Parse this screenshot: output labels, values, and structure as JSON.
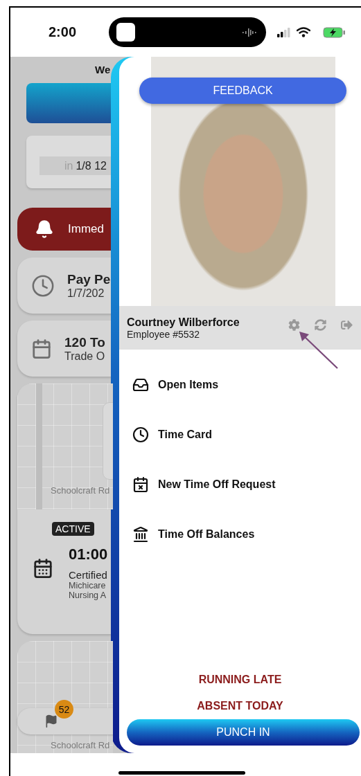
{
  "status_bar": {
    "time": "2:00"
  },
  "background_screen": {
    "heading": "We",
    "clock_prefix": "in",
    "clock_value": "1/8 12",
    "alert": "Immed",
    "cards": [
      {
        "kind": "clock",
        "title": "Pay Pe",
        "subtitle": "1/7/202"
      },
      {
        "kind": "calendar",
        "title": "120 To",
        "subtitle": "Trade O"
      }
    ],
    "shift": {
      "map_label": "Schoolcraft Rd",
      "status": "ACTIVE",
      "time": "01:00",
      "title": "Certified",
      "lines": [
        "Michicare",
        "Nursing A"
      ]
    },
    "map_label_2": "Schoolcraft Rd",
    "badge": "52"
  },
  "drawer": {
    "feedback": "FEEDBACK",
    "profile": {
      "name": "Courtney Wilberforce",
      "employee": "Employee #5532"
    },
    "menu": [
      {
        "kind": "inbox",
        "label": "Open Items"
      },
      {
        "kind": "clock",
        "label": "Time Card"
      },
      {
        "kind": "calendar-x",
        "label": "New Time Off Request"
      },
      {
        "kind": "bank",
        "label": "Time Off Balances"
      }
    ],
    "actions": [
      "RUNNING LATE",
      "ABSENT TODAY"
    ],
    "punch_button": "PUNCH IN"
  }
}
